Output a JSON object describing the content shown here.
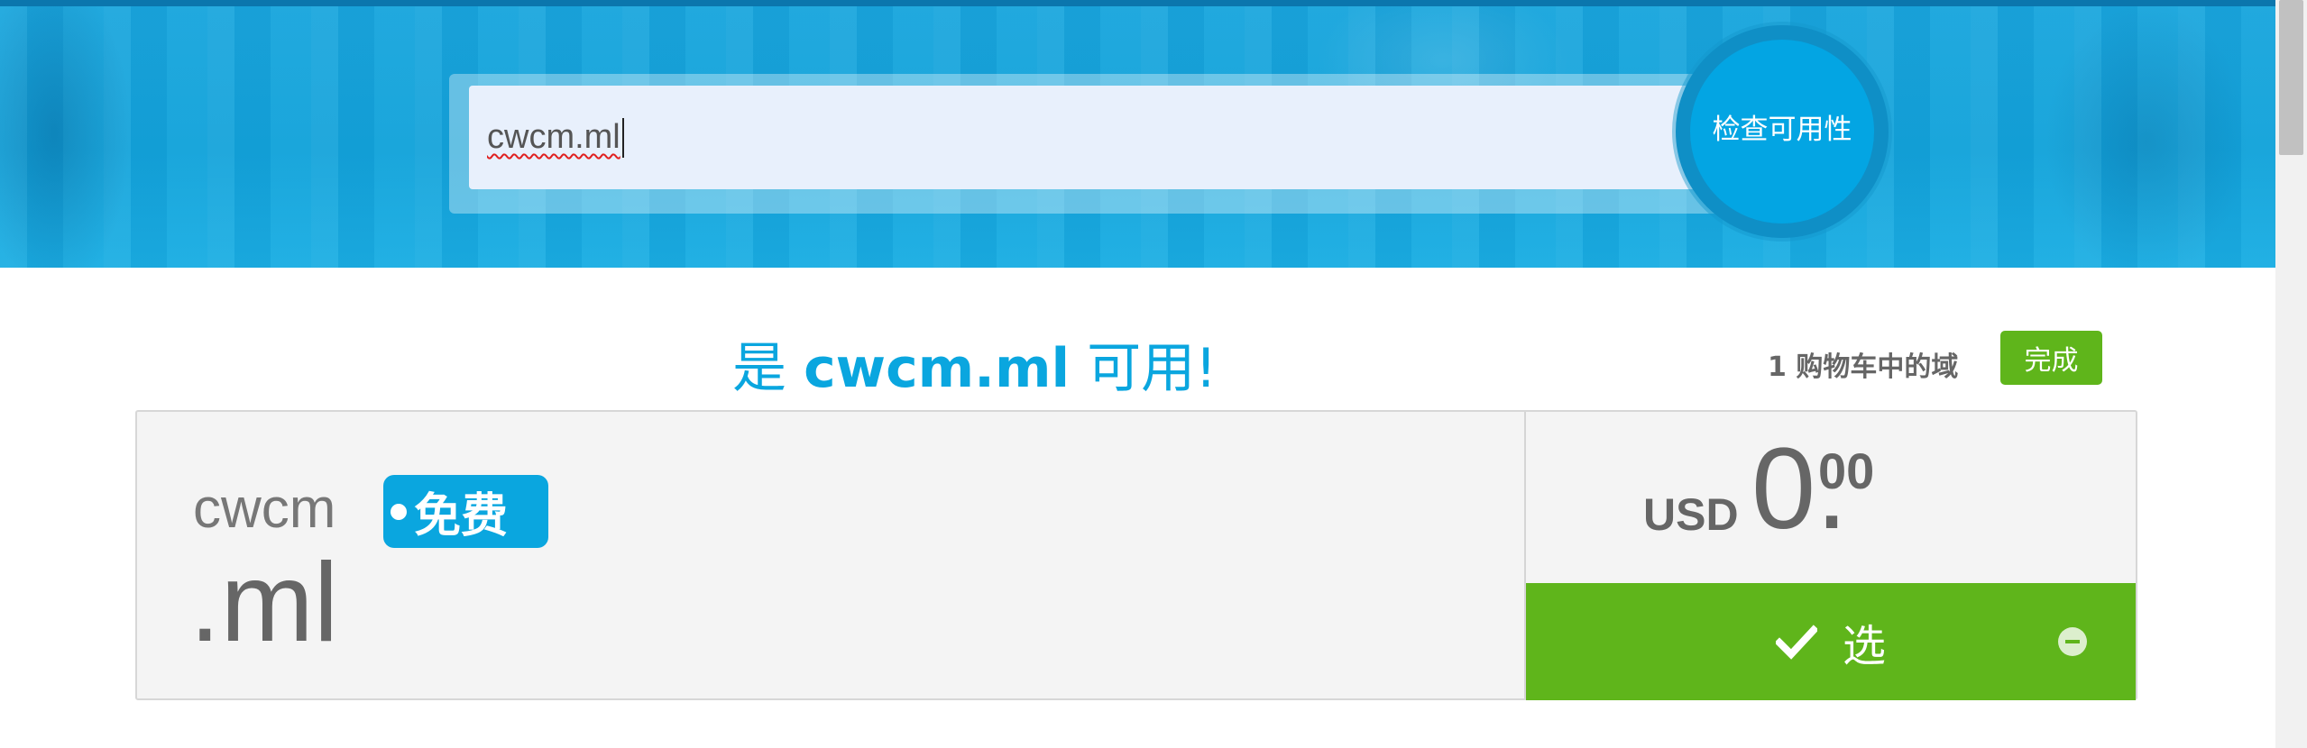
{
  "search": {
    "value": "cwcm.ml",
    "check_button_label": "检查可用性"
  },
  "result": {
    "title_prefix": "是",
    "title_domain": "cwcm.ml",
    "title_suffix": "可用!",
    "cart_count_text": "1 购物车中的域",
    "done_label": "完成"
  },
  "domain_card": {
    "name": "cwcm",
    "tld": ".ml",
    "badge": "免费",
    "currency": "USD",
    "price_integer": "0.",
    "price_decimal": "00",
    "select_label": "选"
  },
  "colors": {
    "brand_blue": "#0aa6df",
    "select_green": "#5fb51b"
  },
  "icons": [
    "check-icon",
    "remove-icon"
  ]
}
